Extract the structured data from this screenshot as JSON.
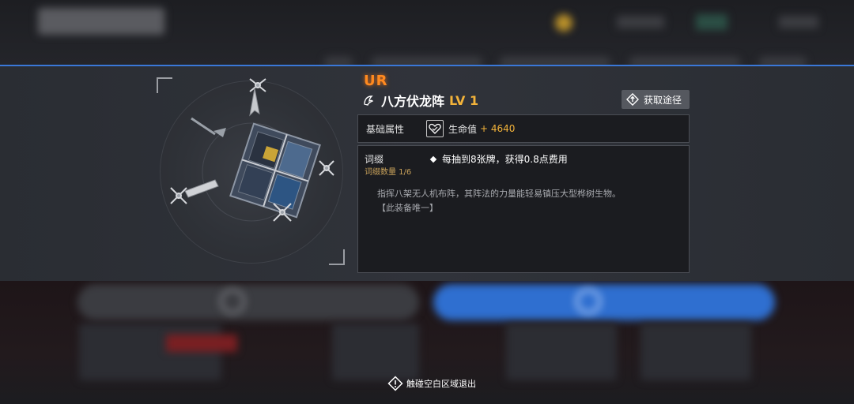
{
  "item": {
    "rarity": "UR",
    "name": "八方伏龙阵",
    "level": "LV 1",
    "source_button_label": "获取途径",
    "icon": "drone-formation-equipment"
  },
  "base_stats": {
    "label": "基础属性",
    "stat_icon": "heart-icon",
    "stat_name": "生命值",
    "stat_value": "+ 4640"
  },
  "affix": {
    "title": "词缀",
    "count_label": "词缀数量 1/6",
    "effect": "每抽到8张牌，获得0.8点费用",
    "description": "指挥八架无人机布阵，其阵法的力量能轻易镇压大型桦树生物。",
    "unique_note": "【此装备唯一】"
  },
  "footer": {
    "exit_hint": "触碰空白区域退出"
  },
  "colors": {
    "rarity": "#ff8a1f",
    "level": "#f3b33a",
    "accent_line": "#3a78d8",
    "confirm_button_bg": "#2f6fd0"
  }
}
